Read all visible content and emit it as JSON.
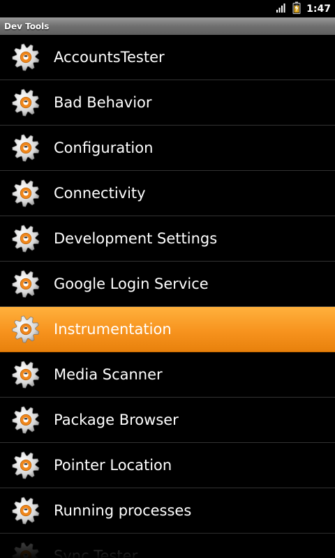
{
  "status_bar": {
    "time": "1:47",
    "icons": [
      "signal-icon",
      "battery-charging-icon"
    ]
  },
  "title_bar": {
    "title": "Dev Tools"
  },
  "list": {
    "items": [
      {
        "label": "AccountsTester",
        "icon": "gear-icon",
        "selected": false
      },
      {
        "label": "Bad Behavior",
        "icon": "gear-icon",
        "selected": false
      },
      {
        "label": "Configuration",
        "icon": "gear-icon",
        "selected": false
      },
      {
        "label": "Connectivity",
        "icon": "gear-icon",
        "selected": false
      },
      {
        "label": "Development Settings",
        "icon": "gear-icon",
        "selected": false
      },
      {
        "label": "Google Login Service",
        "icon": "gear-icon",
        "selected": false
      },
      {
        "label": "Instrumentation",
        "icon": "gear-icon",
        "selected": true
      },
      {
        "label": "Media Scanner",
        "icon": "gear-icon",
        "selected": false
      },
      {
        "label": "Package Browser",
        "icon": "gear-icon",
        "selected": false
      },
      {
        "label": "Pointer Location",
        "icon": "gear-icon",
        "selected": false
      },
      {
        "label": "Running processes",
        "icon": "gear-icon",
        "selected": false
      },
      {
        "label": "Sync Tester",
        "icon": "gear-icon",
        "selected": false
      }
    ]
  },
  "colors": {
    "selected_background": "#f7931e",
    "gear_accent": "#f0861a",
    "background": "#000000"
  }
}
